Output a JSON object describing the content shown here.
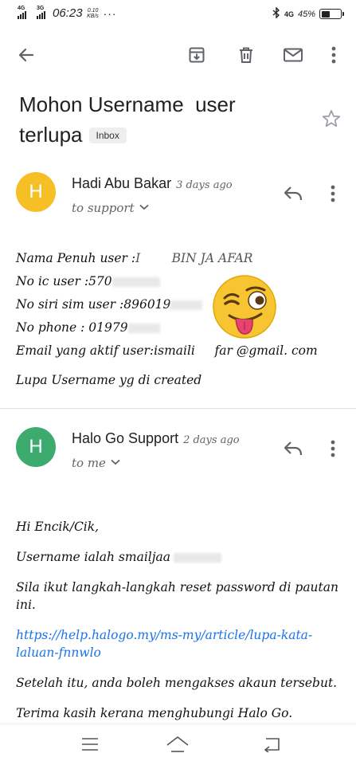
{
  "status_bar": {
    "network1": "4G",
    "network2": "3G",
    "time": "06:23",
    "speed_value": "0.10",
    "speed_unit": "KB/s",
    "dots": "···",
    "net_right": "4G",
    "battery": "45%"
  },
  "toolbar": {
    "back_icon": "arrow-left-icon",
    "archive_icon": "archive-icon",
    "delete_icon": "trash-icon",
    "mark_unread_icon": "mail-icon",
    "more_icon": "more-vertical-icon"
  },
  "email": {
    "subject_line1": "Mohon Username  user",
    "subject_line2": "terlupa",
    "label": "Inbox"
  },
  "messages": [
    {
      "avatar_letter": "H",
      "avatar_color": "#f6bf26",
      "sender": "Hadi Abu Bakar",
      "time": "3 days ago",
      "recipient": "to support",
      "body": [
        {
          "label": "Nama Penuh user :",
          "value": "I        BIN JA AFAR"
        },
        {
          "label": "No ic user :",
          "value": "570"
        },
        {
          "label": "No siri sim user :",
          "value": "896019"
        },
        {
          "label": "No phone : ",
          "value": "01979"
        },
        {
          "label": "Email yang aktif user:",
          "value": "ismaili     far @gmail. com"
        },
        {
          "label": "Lupa Username yg di created",
          "value": ""
        }
      ]
    },
    {
      "avatar_letter": "H",
      "avatar_color": "#3dab6e",
      "sender": "Halo Go Support",
      "time": "2 days ago",
      "recipient": "to me",
      "body": {
        "greeting": "Hi Encik/Cik,",
        "username": "Username ialah smailjaa",
        "instructions": "Sila ikut langkah-langkah reset password di pautan ini.",
        "link": "https://help.halogo.my/ms-my/article/lupa-kata-laluan-fnnwlo",
        "after": "Setelah itu, anda boleh mengakses akaun tersebut.",
        "thanks": "Terima kasih kerana menghubungi Halo Go."
      }
    }
  ],
  "colors": {
    "link": "#1a73e8",
    "icon": "#5f6368"
  },
  "nav": {
    "menu_icon": "menu-icon",
    "home_icon": "home-icon",
    "back_icon": "return-icon"
  }
}
